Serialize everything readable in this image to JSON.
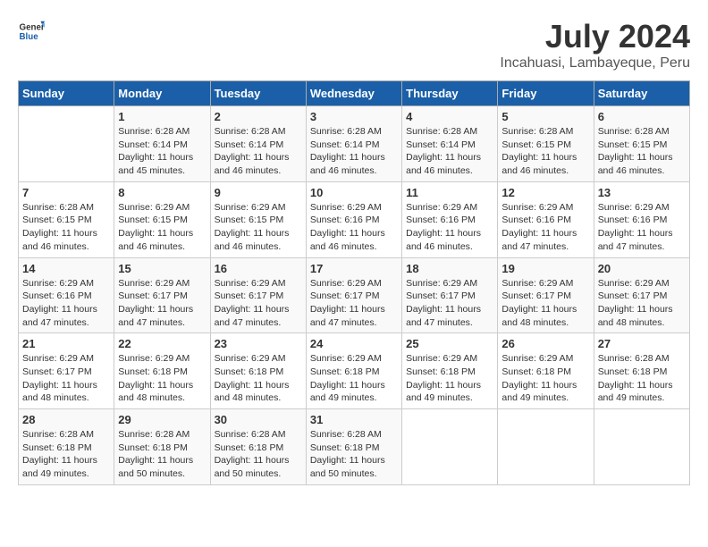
{
  "logo": {
    "text_general": "General",
    "text_blue": "Blue"
  },
  "title": "July 2024",
  "subtitle": "Incahuasi, Lambayeque, Peru",
  "days_of_week": [
    "Sunday",
    "Monday",
    "Tuesday",
    "Wednesday",
    "Thursday",
    "Friday",
    "Saturday"
  ],
  "weeks": [
    [
      {
        "day": "",
        "info": ""
      },
      {
        "day": "1",
        "info": "Sunrise: 6:28 AM\nSunset: 6:14 PM\nDaylight: 11 hours and 45 minutes."
      },
      {
        "day": "2",
        "info": "Sunrise: 6:28 AM\nSunset: 6:14 PM\nDaylight: 11 hours and 46 minutes."
      },
      {
        "day": "3",
        "info": "Sunrise: 6:28 AM\nSunset: 6:14 PM\nDaylight: 11 hours and 46 minutes."
      },
      {
        "day": "4",
        "info": "Sunrise: 6:28 AM\nSunset: 6:14 PM\nDaylight: 11 hours and 46 minutes."
      },
      {
        "day": "5",
        "info": "Sunrise: 6:28 AM\nSunset: 6:15 PM\nDaylight: 11 hours and 46 minutes."
      },
      {
        "day": "6",
        "info": "Sunrise: 6:28 AM\nSunset: 6:15 PM\nDaylight: 11 hours and 46 minutes."
      }
    ],
    [
      {
        "day": "7",
        "info": "Sunrise: 6:28 AM\nSunset: 6:15 PM\nDaylight: 11 hours and 46 minutes."
      },
      {
        "day": "8",
        "info": "Sunrise: 6:29 AM\nSunset: 6:15 PM\nDaylight: 11 hours and 46 minutes."
      },
      {
        "day": "9",
        "info": "Sunrise: 6:29 AM\nSunset: 6:15 PM\nDaylight: 11 hours and 46 minutes."
      },
      {
        "day": "10",
        "info": "Sunrise: 6:29 AM\nSunset: 6:16 PM\nDaylight: 11 hours and 46 minutes."
      },
      {
        "day": "11",
        "info": "Sunrise: 6:29 AM\nSunset: 6:16 PM\nDaylight: 11 hours and 46 minutes."
      },
      {
        "day": "12",
        "info": "Sunrise: 6:29 AM\nSunset: 6:16 PM\nDaylight: 11 hours and 47 minutes."
      },
      {
        "day": "13",
        "info": "Sunrise: 6:29 AM\nSunset: 6:16 PM\nDaylight: 11 hours and 47 minutes."
      }
    ],
    [
      {
        "day": "14",
        "info": "Sunrise: 6:29 AM\nSunset: 6:16 PM\nDaylight: 11 hours and 47 minutes."
      },
      {
        "day": "15",
        "info": "Sunrise: 6:29 AM\nSunset: 6:17 PM\nDaylight: 11 hours and 47 minutes."
      },
      {
        "day": "16",
        "info": "Sunrise: 6:29 AM\nSunset: 6:17 PM\nDaylight: 11 hours and 47 minutes."
      },
      {
        "day": "17",
        "info": "Sunrise: 6:29 AM\nSunset: 6:17 PM\nDaylight: 11 hours and 47 minutes."
      },
      {
        "day": "18",
        "info": "Sunrise: 6:29 AM\nSunset: 6:17 PM\nDaylight: 11 hours and 47 minutes."
      },
      {
        "day": "19",
        "info": "Sunrise: 6:29 AM\nSunset: 6:17 PM\nDaylight: 11 hours and 48 minutes."
      },
      {
        "day": "20",
        "info": "Sunrise: 6:29 AM\nSunset: 6:17 PM\nDaylight: 11 hours and 48 minutes."
      }
    ],
    [
      {
        "day": "21",
        "info": "Sunrise: 6:29 AM\nSunset: 6:17 PM\nDaylight: 11 hours and 48 minutes."
      },
      {
        "day": "22",
        "info": "Sunrise: 6:29 AM\nSunset: 6:18 PM\nDaylight: 11 hours and 48 minutes."
      },
      {
        "day": "23",
        "info": "Sunrise: 6:29 AM\nSunset: 6:18 PM\nDaylight: 11 hours and 48 minutes."
      },
      {
        "day": "24",
        "info": "Sunrise: 6:29 AM\nSunset: 6:18 PM\nDaylight: 11 hours and 49 minutes."
      },
      {
        "day": "25",
        "info": "Sunrise: 6:29 AM\nSunset: 6:18 PM\nDaylight: 11 hours and 49 minutes."
      },
      {
        "day": "26",
        "info": "Sunrise: 6:29 AM\nSunset: 6:18 PM\nDaylight: 11 hours and 49 minutes."
      },
      {
        "day": "27",
        "info": "Sunrise: 6:28 AM\nSunset: 6:18 PM\nDaylight: 11 hours and 49 minutes."
      }
    ],
    [
      {
        "day": "28",
        "info": "Sunrise: 6:28 AM\nSunset: 6:18 PM\nDaylight: 11 hours and 49 minutes."
      },
      {
        "day": "29",
        "info": "Sunrise: 6:28 AM\nSunset: 6:18 PM\nDaylight: 11 hours and 50 minutes."
      },
      {
        "day": "30",
        "info": "Sunrise: 6:28 AM\nSunset: 6:18 PM\nDaylight: 11 hours and 50 minutes."
      },
      {
        "day": "31",
        "info": "Sunrise: 6:28 AM\nSunset: 6:18 PM\nDaylight: 11 hours and 50 minutes."
      },
      {
        "day": "",
        "info": ""
      },
      {
        "day": "",
        "info": ""
      },
      {
        "day": "",
        "info": ""
      }
    ]
  ]
}
